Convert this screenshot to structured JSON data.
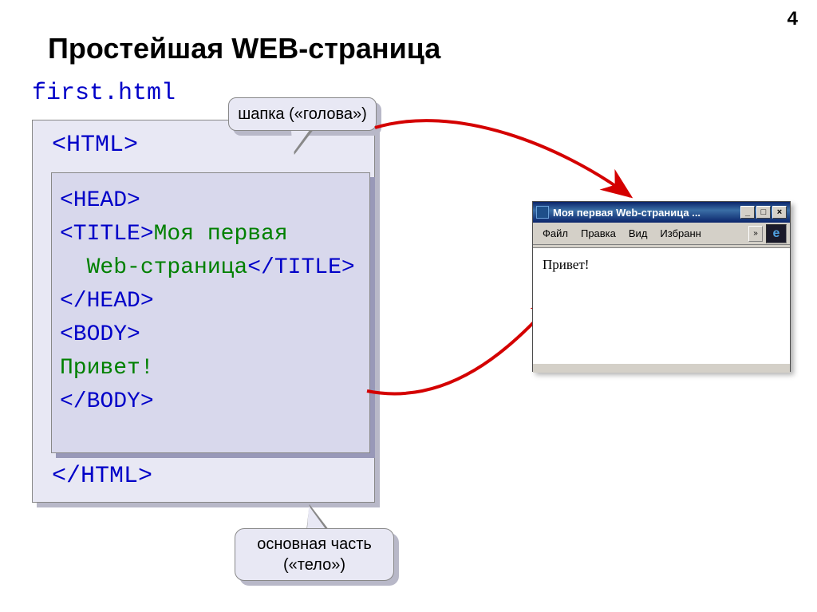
{
  "page_number": "4",
  "title": "Простейшая WEB-страница",
  "filename": "first.html",
  "code": {
    "html_open": "<HTML>",
    "html_close": "</HTML>",
    "head_open": "<HEAD>",
    "title_open": "<TITLE>",
    "title_text1": "Моя первая",
    "title_text2": "Web-страница",
    "title_close": "</TITLE>",
    "head_close": "</HEAD>",
    "body_open": "<BODY>",
    "body_text": "Привет!",
    "body_close": "</BODY>"
  },
  "callout_top": "шапка («голова»)",
  "callout_bottom_line1": "основная часть",
  "callout_bottom_line2": "(«тело»)",
  "browser": {
    "title": "Моя первая Web-страница ...",
    "menu": {
      "file": "Файл",
      "edit": "Правка",
      "view": "Вид",
      "favorites": "Избранн"
    },
    "content": "Привет!"
  }
}
